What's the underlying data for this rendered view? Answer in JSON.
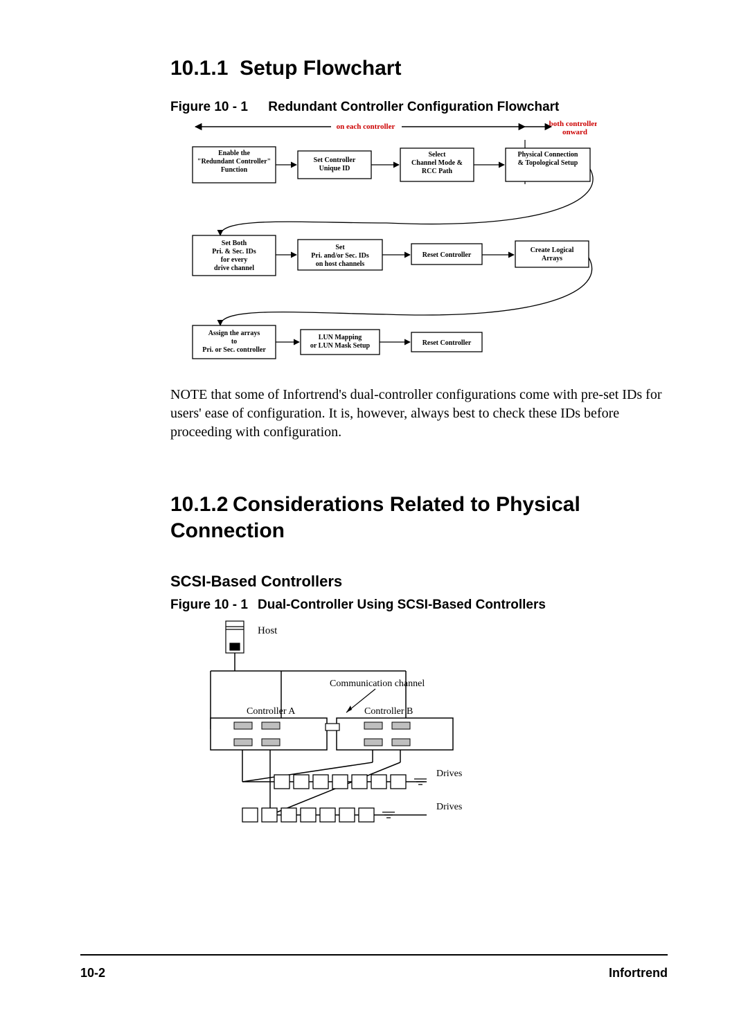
{
  "section1": {
    "number": "10.1.1",
    "title": "Setup Flowchart",
    "figure_lead": "Figure 10 - 1",
    "figure_title": "Redundant Controller Configuration Flowchart"
  },
  "flowchart": {
    "top_span_label": "on each controller",
    "top_right_label": "both controllers onward",
    "row1": {
      "a": "Enable the \"Redundant Controller\" Function",
      "b": "Set Controller Unique ID",
      "c": "Select Channel Mode & RCC Path",
      "d": "Physical Connection & Topological Setup"
    },
    "row2": {
      "a": "Set Both Pri. & Sec. IDs for every drive channel",
      "b": "Set Pri. and/or Sec. IDs on host channels",
      "c": "Reset Controller",
      "d": "Create Logical Arrays"
    },
    "row3": {
      "a": "Assign the arrays to Pri. or Sec. controller",
      "b": "LUN Mapping or LUN Mask Setup",
      "c": "Reset Controller"
    }
  },
  "note_text": "NOTE that some of Infortrend's dual-controller configurations come with pre-set IDs for users' ease of configuration.  It is, however, always best to check these IDs before proceeding with configuration.",
  "section2": {
    "number": "10.1.2",
    "title": "Considerations Related to Physical Connection",
    "sub": "SCSI-Based Controllers",
    "figure_lead": "Figure 10 - 1",
    "figure_title": "Dual-Controller Using SCSI-Based Controllers"
  },
  "fig2": {
    "host": "Host",
    "comm": "Communication channel",
    "ctrl_a": "Controller A",
    "ctrl_b": "Controller B",
    "drives": "Drives"
  },
  "footer": {
    "page": "10-2",
    "brand": "Infortrend"
  }
}
